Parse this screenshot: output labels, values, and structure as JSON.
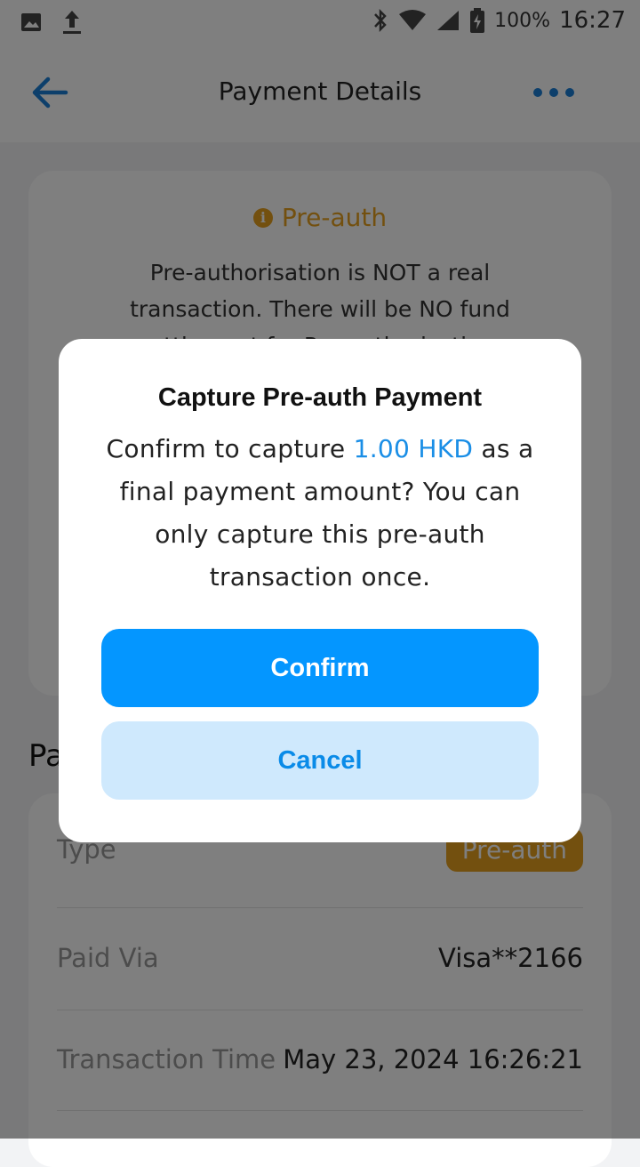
{
  "status_bar": {
    "battery": "100%",
    "time": "16:27"
  },
  "app_bar": {
    "title": "Payment Details"
  },
  "preauth_card": {
    "heading": "Pre-auth",
    "note": "Pre-authorisation is NOT a real transaction. There will be NO fund settlement for Pre-authorisation."
  },
  "section": {
    "title": "Payment"
  },
  "details": {
    "rows": [
      {
        "label": "Type",
        "value": "Pre-auth"
      },
      {
        "label": "Paid Via",
        "value": "Visa**2166"
      },
      {
        "label": "Transaction Time",
        "value": "May 23, 2024 16:26:21"
      }
    ]
  },
  "dialog": {
    "title": "Capture Pre-auth Payment",
    "message_before": "Confirm to capture ",
    "amount": "1.00 HKD",
    "message_after": " as a final payment amount? You can only capture this pre-auth transaction once.",
    "confirm_label": "Confirm",
    "cancel_label": "Cancel"
  },
  "colors": {
    "accent": "#0496ff",
    "preauth": "#e6a01f"
  }
}
